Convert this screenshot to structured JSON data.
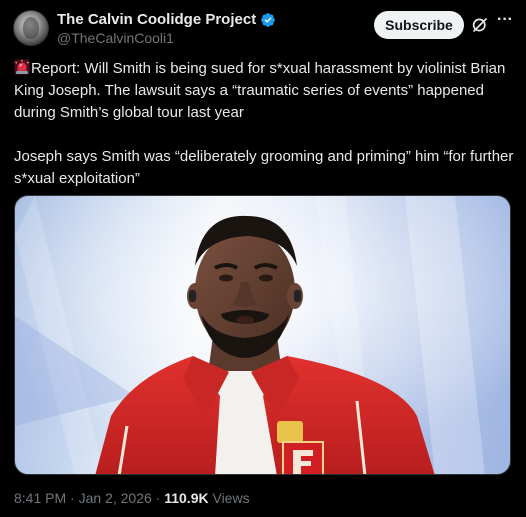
{
  "header": {
    "display_name": "The Calvin Coolidge Project",
    "handle": "@TheCalvinCooli1",
    "subscribe_label": "Subscribe",
    "verified_color": "#1d9bf0"
  },
  "tweet": {
    "paragraph1": "Report: Will Smith is being sued for s*xual harassment by violinist Brian King Joseph. The lawsuit says a “traumatic series of events” happened during Smith’s global tour last year",
    "paragraph2": "Joseph says Smith was “deliberately grooming and priming” him “for further s*xual exploitation”",
    "lead_icon": "siren-icon"
  },
  "meta": {
    "time": "8:41 PM",
    "date": "Jan 2, 2026",
    "views_count": "110.9K",
    "views_label": "Views",
    "separator": "·"
  },
  "colors": {
    "background": "#000000",
    "text": "#e7e9ea",
    "muted": "#71767b",
    "jacket_red": "#d42a2a"
  }
}
